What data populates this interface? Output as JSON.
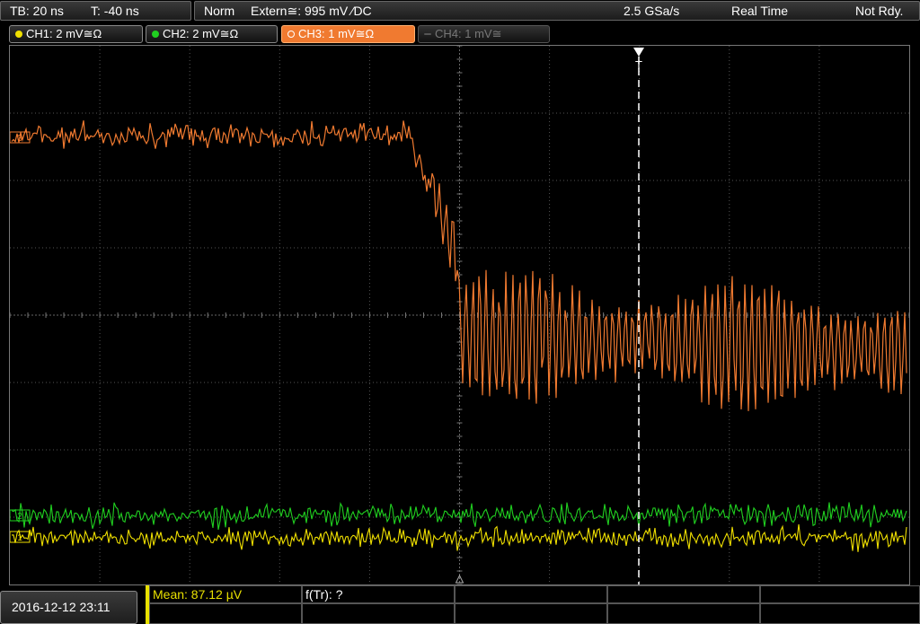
{
  "top_bar": {
    "timebase": "TB: 20 ns",
    "trigger_offset": "T: -40 ns",
    "trigger_mode": "Norm",
    "trigger_source": "Extern≅: 995 mV ⁄DC",
    "sample_rate": "2.5 GSa/s",
    "acq_mode": "Real Time",
    "status": "Not Rdy."
  },
  "channels": [
    {
      "label": "CH1: 2 mV≅Ω",
      "color": "#f0e000",
      "state": "on"
    },
    {
      "label": "CH2: 2 mV≅Ω",
      "color": "#20d020",
      "state": "on"
    },
    {
      "label": "CH3: 1 mV≅Ω",
      "color": "#f07a30",
      "state": "active"
    },
    {
      "label": "CH4: 1 mV≅",
      "color": "#777777",
      "state": "off"
    }
  ],
  "screen": {
    "trigger_marker": "T",
    "ch3_marker": "3",
    "ch2_marker": "2",
    "ch1_marker": "1"
  },
  "bottom": {
    "datetime": "2016-12-12 23:11",
    "mean_label": "Mean: 87.12 µV",
    "ftr_label": "f(Tr): ?"
  },
  "colors": {
    "ch1": "#f0e000",
    "ch2": "#20d020",
    "ch3": "#f07a30",
    "grid": "#555555"
  }
}
